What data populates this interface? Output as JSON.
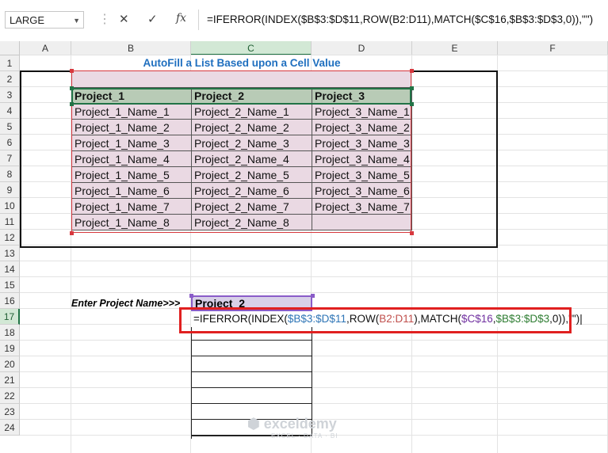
{
  "formula_bar": {
    "name_box": "LARGE",
    "cancel_icon": "✕",
    "enter_icon": "✓",
    "fx_label": "fx",
    "formula": "=IFERROR(INDEX($B$3:$D$11,ROW(B2:D11),MATCH($C$16,$B$3:$D$3,0)),\"\")"
  },
  "columns": [
    "A",
    "B",
    "C",
    "D",
    "E",
    "F"
  ],
  "rows": [
    "1",
    "2",
    "3",
    "4",
    "5",
    "6",
    "7",
    "8",
    "9",
    "10",
    "11",
    "12",
    "13",
    "14",
    "15",
    "16",
    "17",
    "18",
    "19",
    "20",
    "21",
    "22",
    "23",
    "24"
  ],
  "sheet": {
    "title": "AutoFill a List Based upon a Cell Value",
    "headers": [
      "Project_1",
      "Project_2",
      "Project_3"
    ],
    "table": [
      [
        "Project_1_Name_1",
        "Project_2_Name_1",
        "Project_3_Name_1"
      ],
      [
        "Project_1_Name_2",
        "Project_2_Name_2",
        "Project_3_Name_2"
      ],
      [
        "Project_1_Name_3",
        "Project_2_Name_3",
        "Project_3_Name_3"
      ],
      [
        "Project_1_Name_4",
        "Project_2_Name_4",
        "Project_3_Name_4"
      ],
      [
        "Project_1_Name_5",
        "Project_2_Name_5",
        "Project_3_Name_5"
      ],
      [
        "Project_1_Name_6",
        "Project_2_Name_6",
        "Project_3_Name_6"
      ],
      [
        "Project_1_Name_7",
        "Project_2_Name_7",
        "Project_3_Name_7"
      ],
      [
        "Project_1_Name_8",
        "Project_2_Name_8",
        ""
      ]
    ],
    "input_label": "Enter Project Name>>>",
    "input_value": "Project_2",
    "edit_formula_parts": {
      "p1": "=IFERROR(INDEX(",
      "p2": "$B$3:$D$11",
      "p3": ",ROW(",
      "p4": "B2:D11",
      "p5": "),MATCH(",
      "p6": "$C$16",
      "p7": ",",
      "p8": "$B$3:$D$3",
      "p9": ",0)),\"\")"
    }
  },
  "watermark": {
    "brand": "exceldemy",
    "tagline": "EXCEL · DATA · BI"
  },
  "colors": {
    "accent_green": "#217346",
    "title_blue": "#1f6fbf",
    "highlight_red": "#e02020"
  }
}
